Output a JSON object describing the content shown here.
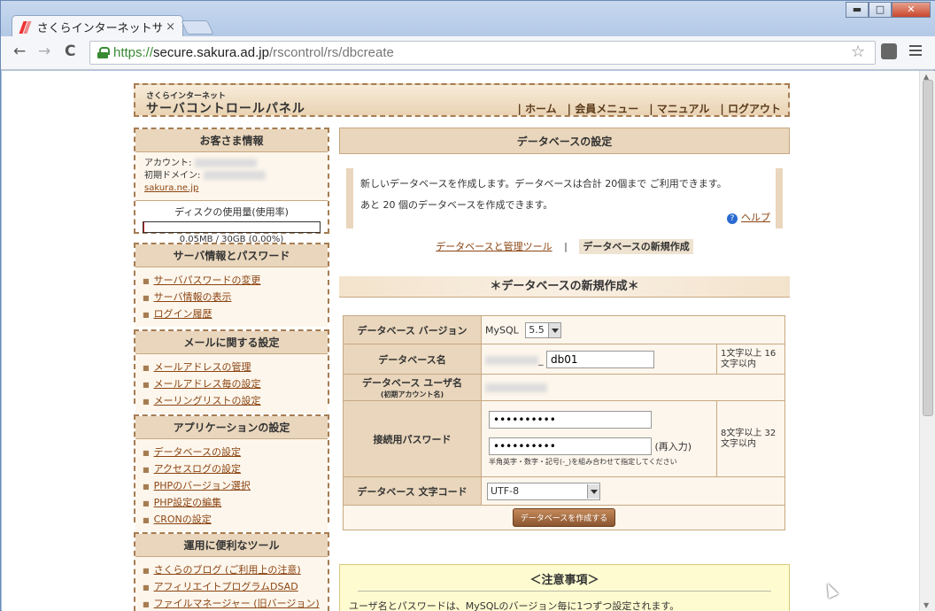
{
  "browser": {
    "tab_title": "さくらインターネットサ",
    "tab_close": "×",
    "url_https": "https://",
    "url_host": "secure.sakura.ad.jp",
    "url_path": "/rscontrol/rs/dbcreate",
    "back": "←",
    "forward": "→",
    "reload": "C",
    "star": "☆",
    "win_min": "▬",
    "win_max": "□",
    "win_close": "✕"
  },
  "header": {
    "logo_small": "さくらインターネット",
    "logo": "サーバコントロールパネル",
    "nav": [
      "ホーム",
      "会員メニュー",
      "マニュアル",
      "ログアウト"
    ]
  },
  "sidebar": {
    "customer": {
      "title": "お客さま情報",
      "account_label": "アカウント:",
      "domain_label": "初期ドメイン:",
      "domain_suffix": "sakura.ne.jp",
      "disk_title": "ディスクの使用量(使用率)",
      "disk_value": "0.05MB / 30GB (0.00%)",
      "disk_usage_fraction": 0.0
    },
    "server": {
      "title": "サーバ情報とパスワード",
      "items": [
        "サーバパスワードの変更",
        "サーバ情報の表示",
        "ログイン履歴"
      ]
    },
    "mail": {
      "title": "メールに関する設定",
      "items": [
        "メールアドレスの管理",
        "メールアドレス毎の設定",
        "メーリングリストの設定"
      ]
    },
    "apps": {
      "title": "アプリケーションの設定",
      "items": [
        "データベースの設定",
        "アクセスログの設定",
        "PHPのバージョン選択",
        "PHP設定の編集",
        "CRONの設定"
      ]
    },
    "tools": {
      "title": "運用に便利なツール",
      "items": [
        "さくらのブログ (ご利用上の注意)",
        "アフィリエイトプログラムDSAD",
        "ファイルマネージャー (旧バージョン)"
      ]
    }
  },
  "main": {
    "title": "データベースの設定",
    "info_line1": "新しいデータベースを作成します。データベースは合計 20個まで ご利用できます。",
    "info_line2": "あと 20 個のデータベースを作成できます。",
    "help": "ヘルプ",
    "subnav_link": "データベースと管理ツール",
    "subnav_sep": "|",
    "subnav_current": "データベースの新規作成",
    "create_title": "＊データベースの新規作成＊",
    "form": {
      "version_label": "データベース バージョン",
      "version_prefix": "MySQL",
      "version_value": "5.5",
      "dbname_label": "データベース名",
      "dbname_sep": "_",
      "dbname_value": "db01",
      "dbname_hint": "1文字以上 16文字以内",
      "user_label": "データベース ユーザ名",
      "user_sublabel": "(初期アカウント名)",
      "password_label": "接続用パスワード",
      "password_value": "••••••••••",
      "password_confirm_value": "••••••••••",
      "reenter": "(再入力)",
      "password_note": "半角英字・数字・記号(-_)を組み合わせて指定してください",
      "password_hint": "8文字以上 32文字以内",
      "charset_label": "データベース 文字コード",
      "charset_value": "UTF-8",
      "submit": "データベースを作成する"
    },
    "notes_title": "＜注意事項＞",
    "notes_line": "ユーザ名とパスワードは、MySQLのバージョン毎に1つずつ設定されます。"
  }
}
